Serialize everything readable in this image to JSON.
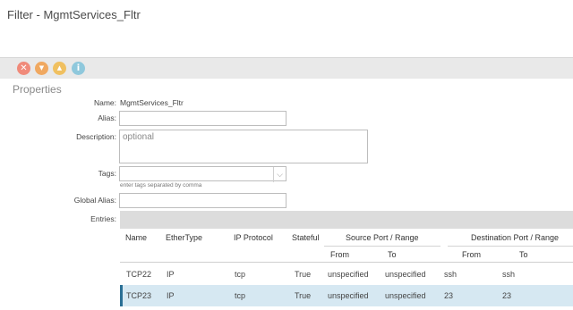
{
  "window": {
    "title": "Filter - MgmtServices_Fltr"
  },
  "toolbar": {
    "icons": [
      {
        "name": "delete-icon",
        "color": "#f08a7a",
        "glyph": "✕"
      },
      {
        "name": "fault-icon",
        "color": "#f0a860",
        "glyph": "▼"
      },
      {
        "name": "warning-icon",
        "color": "#f0c060",
        "glyph": "▲"
      },
      {
        "name": "info-icon",
        "color": "#8fc8dc",
        "glyph": "i"
      }
    ]
  },
  "properties": {
    "section_title": "Properties",
    "name_label": "Name:",
    "name_value": "MgmtServices_Fltr",
    "alias_label": "Alias:",
    "alias_value": "",
    "description_label": "Description:",
    "description_placeholder": "optional",
    "tags_label": "Tags:",
    "tags_hint": "enter tags separated by comma",
    "global_alias_label": "Global Alias:",
    "entries_label": "Entries:"
  },
  "entries": {
    "columns": {
      "name": "Name",
      "ethertype": "EtherType",
      "ip_protocol": "IP Protocol",
      "stateful": "Stateful",
      "source_port": "Source Port / Range",
      "dest_port": "Destination Port / Range",
      "from": "From",
      "to": "To"
    },
    "rows": [
      {
        "name": "TCP22",
        "ethertype": "IP",
        "ip_protocol": "tcp",
        "stateful": "True",
        "src_from": "unspecified",
        "src_to": "unspecified",
        "dst_from": "ssh",
        "dst_to": "ssh"
      },
      {
        "name": "TCP23",
        "ethertype": "IP",
        "ip_protocol": "tcp",
        "stateful": "True",
        "src_from": "unspecified",
        "src_to": "unspecified",
        "dst_from": "23",
        "dst_to": "23"
      }
    ]
  }
}
